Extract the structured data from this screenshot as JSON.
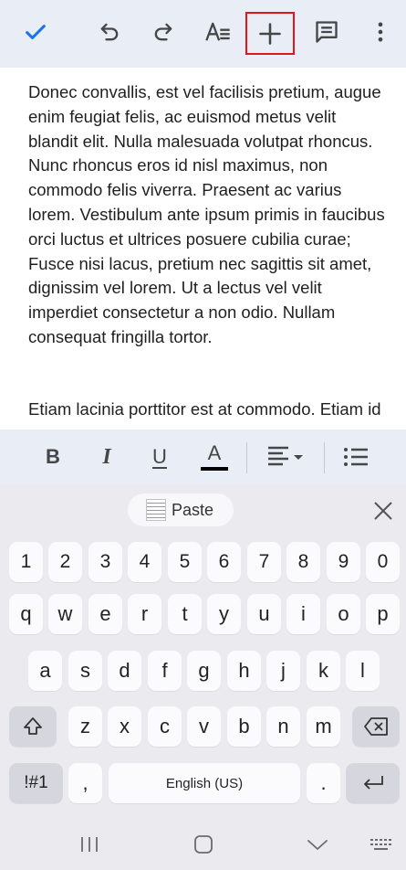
{
  "toolbar": {
    "items": [
      {
        "id": "done",
        "icon": "check-icon"
      },
      {
        "id": "undo",
        "icon": "undo-icon"
      },
      {
        "id": "redo",
        "icon": "redo-icon"
      },
      {
        "id": "text-format",
        "icon": "text-format-icon"
      },
      {
        "id": "insert",
        "icon": "plus-icon",
        "highlighted": true
      },
      {
        "id": "comment",
        "icon": "comment-icon"
      },
      {
        "id": "more",
        "icon": "more-vert-icon"
      }
    ],
    "accent_color": "#1a73e8",
    "highlight_color": "#e1141b"
  },
  "document": {
    "paragraphs": [
      "Donec convallis, est vel facilisis pretium, augue enim feugiat felis, ac euismod metus velit blandit elit. Nulla malesuada volutpat rhoncus. Nunc rhoncus eros id nisl maximus, non commodo felis viverra. Praesent ac varius lorem. Vestibulum ante ipsum primis in faucibus orci luctus et ultrices posuere cubilia curae; Fusce nisi lacus, pretium nec sagittis sit amet, dignissim vel lorem. Ut a lectus vel velit imperdiet consectetur a non odio. Nullam consequat fringilla tortor.",
      "Etiam lacinia porttitor est at commodo. Etiam id"
    ]
  },
  "format_bar": {
    "items": [
      {
        "id": "bold",
        "label": "B",
        "icon": "bold-icon"
      },
      {
        "id": "italic",
        "label": "I",
        "icon": "italic-icon"
      },
      {
        "id": "underline",
        "label": "U",
        "icon": "underline-icon"
      },
      {
        "id": "text-color",
        "label": "A",
        "icon": "text-color-icon",
        "color": "#000000"
      },
      {
        "id": "align",
        "icon": "align-left-icon"
      },
      {
        "id": "list",
        "icon": "bulleted-list-icon"
      }
    ]
  },
  "keyboard": {
    "suggestion": {
      "paste_label": "Paste",
      "close_icon": "close-icon"
    },
    "rows": {
      "numbers": [
        "1",
        "2",
        "3",
        "4",
        "5",
        "6",
        "7",
        "8",
        "9",
        "0"
      ],
      "row1": [
        "q",
        "w",
        "e",
        "r",
        "t",
        "y",
        "u",
        "i",
        "o",
        "p"
      ],
      "row2": [
        "a",
        "s",
        "d",
        "f",
        "g",
        "h",
        "j",
        "k",
        "l"
      ],
      "row3": [
        "z",
        "x",
        "c",
        "v",
        "b",
        "n",
        "m"
      ]
    },
    "symbols_label": "!#1",
    "comma_label": ",",
    "space_label": "English (US)",
    "period_label": ".",
    "shift_icon": "shift-icon",
    "backspace_icon": "backspace-icon",
    "enter_icon": "enter-icon"
  },
  "navbar": {
    "items": [
      "recent-apps-icon",
      "home-icon",
      "back-icon",
      "keyboard-switch-icon"
    ]
  }
}
